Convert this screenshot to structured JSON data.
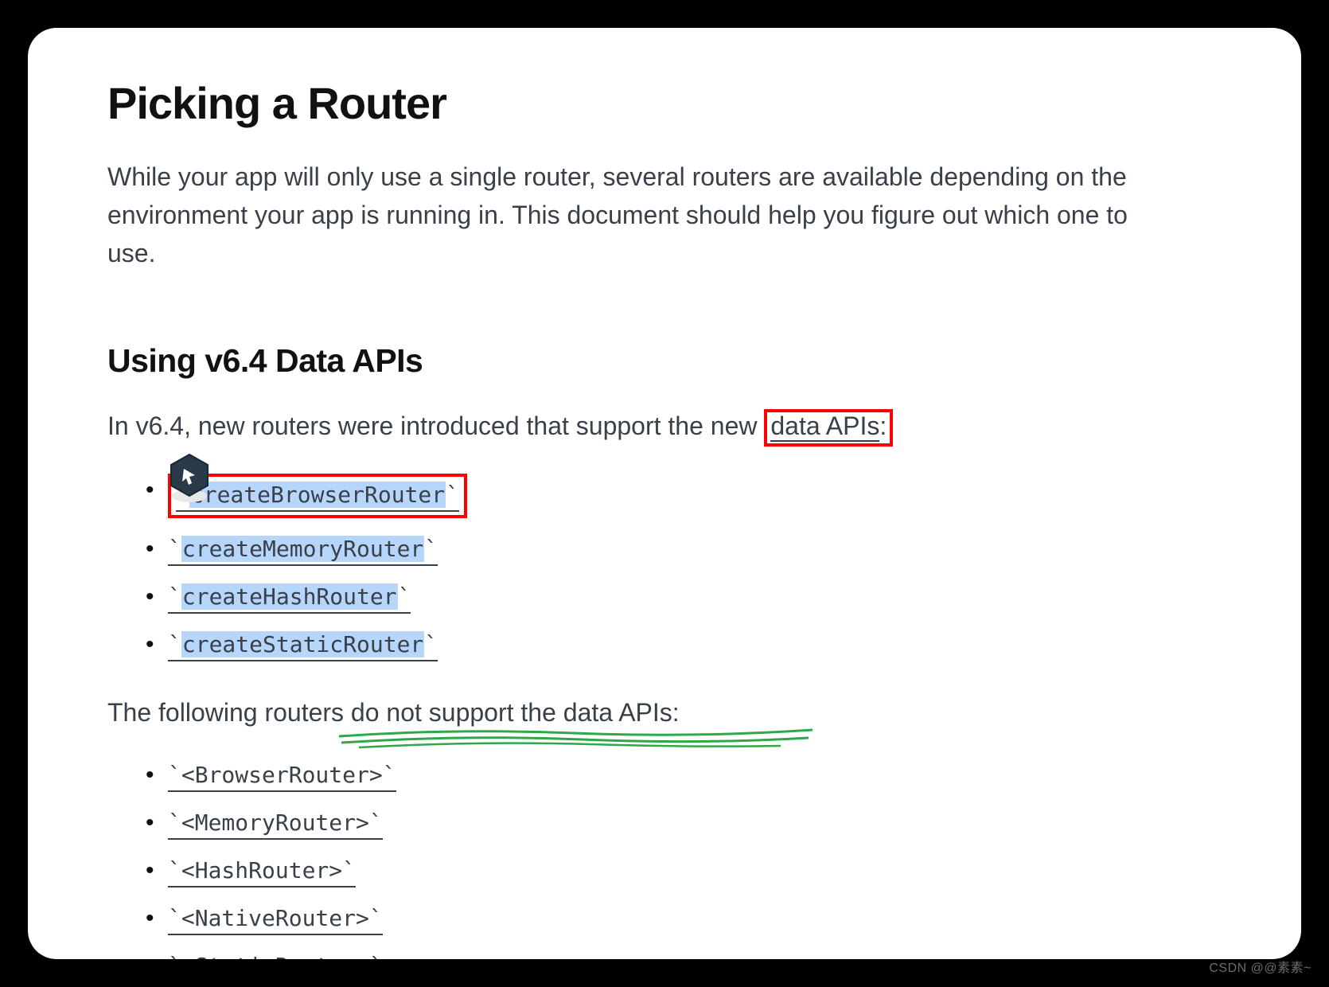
{
  "page_title": "Picking a Router",
  "intro": "While your app will only use a single router, several routers are available depending on the environment your app is running in. This document should help you figure out which one to use.",
  "section": {
    "heading": "Using v6.4 Data APIs",
    "para1_prefix": "In v6.4, new routers were introduced that support the new ",
    "para1_link": "data APIs",
    "para1_suffix": ":",
    "supported": [
      "createBrowserRouter",
      "createMemoryRouter",
      "createHashRouter",
      "createStaticRouter"
    ],
    "para2_prefix": "The following routers ",
    "para2_emph": "do not support the data APIs:",
    "unsupported": [
      "<BrowserRouter>",
      "<MemoryRouter>",
      "<HashRouter>",
      "<NativeRouter>",
      "<StaticRouter>"
    ]
  },
  "watermark": "CSDN @@素素~"
}
